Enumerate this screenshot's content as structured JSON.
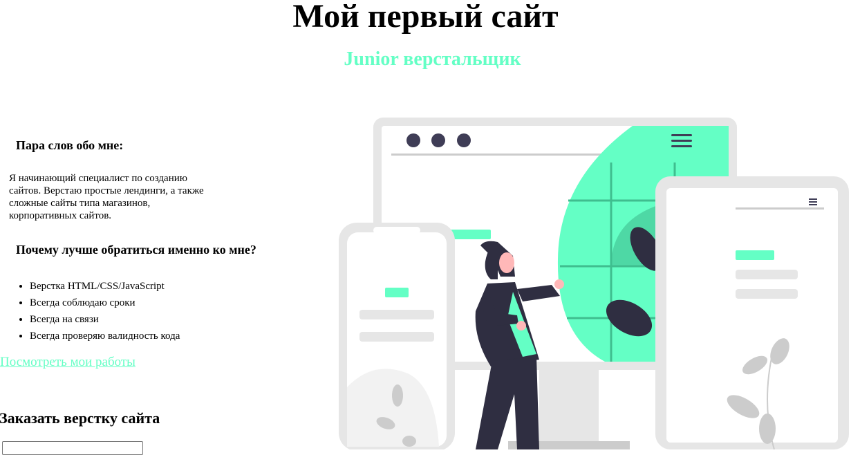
{
  "header": {
    "title": "Мой первый сайт",
    "subtitle": "Junior верстальщик"
  },
  "about": {
    "heading": "Пара слов обо мне:",
    "text": "Я начинающий специалист по созданию сайтов. Верстаю простые лендинги, а также сложные сайты типа магазинов, корпоративных сайтов."
  },
  "why": {
    "heading": "Почему лучше обратиться именно ко мне?",
    "items": [
      "Верстка HTML/CSS/JavaScript",
      "Всегда соблюдаю сроки",
      "Всегда на связи",
      "Всегда проверяю валидность кода"
    ]
  },
  "works_link": "Посмотреть мои работы",
  "order": {
    "heading": "Заказать верстку сайта",
    "input_value": ""
  },
  "colors": {
    "accent": "#64ffc5",
    "dark": "#2f2e41",
    "device_gray": "#e6e6e6"
  },
  "illustration_icon": "developer-with-devices-illustration"
}
